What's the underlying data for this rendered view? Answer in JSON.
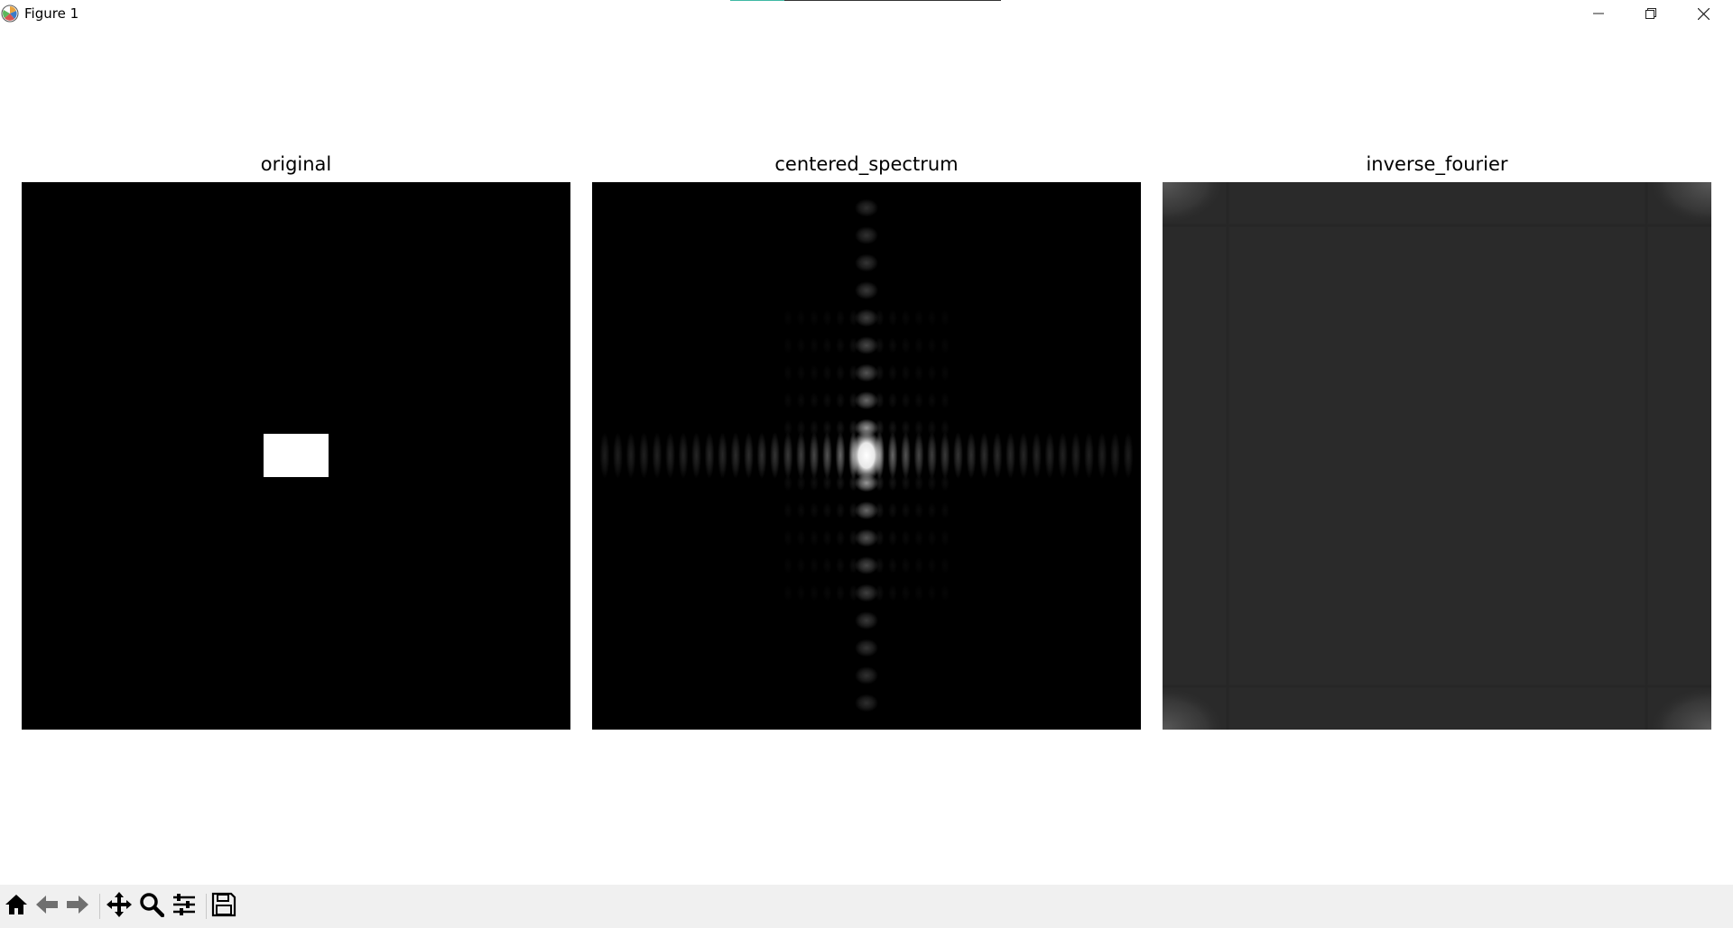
{
  "window": {
    "title": "Figure 1",
    "icon": "matplotlib-icon",
    "controls": [
      "minimize-icon",
      "restore-icon",
      "close-icon"
    ]
  },
  "figure": {
    "panels": [
      {
        "title": "original"
      },
      {
        "title": "centered_spectrum"
      },
      {
        "title": "inverse_fourier"
      }
    ]
  },
  "toolbar": {
    "buttons": [
      {
        "icon": "home-icon"
      },
      {
        "icon": "back-arrow-icon"
      },
      {
        "icon": "forward-arrow-icon"
      },
      {
        "icon": "pan-icon"
      },
      {
        "icon": "zoom-icon"
      },
      {
        "icon": "configure-subplots-icon"
      },
      {
        "icon": "save-icon"
      }
    ]
  },
  "colors": {
    "image_background": "#000000",
    "inverse_background": "#2a2a2a",
    "toolbar_background": "#f0f0f0",
    "accent": "#3fb9a4"
  }
}
